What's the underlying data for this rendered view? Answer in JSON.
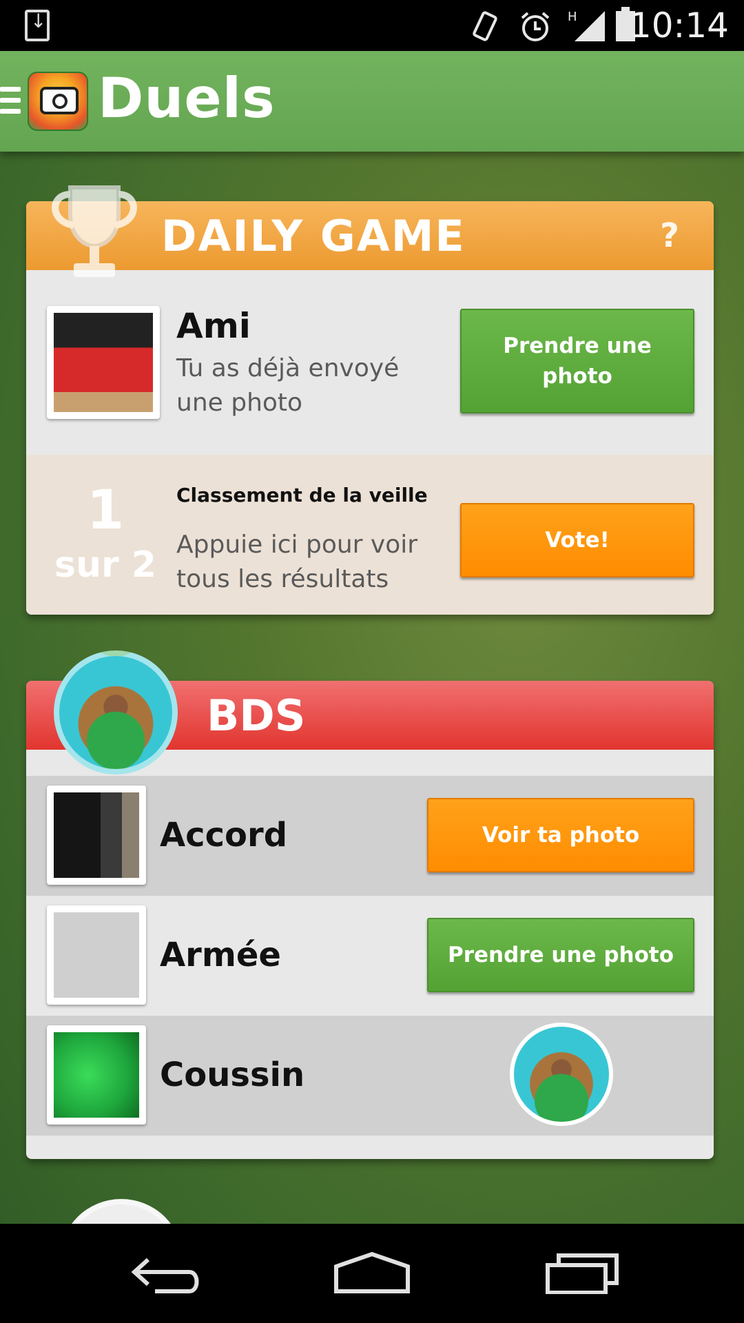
{
  "status_bar": {
    "time": "10:14",
    "icons": [
      "download-icon",
      "vibrate-icon",
      "alarm-icon",
      "signal-icon",
      "battery-icon"
    ]
  },
  "app_bar": {
    "title": "Duels"
  },
  "daily_game": {
    "header": "DAILY GAME",
    "help": "?",
    "entry": {
      "title": "Ami",
      "subtitle": "Tu as déjà envoyé une photo",
      "button": "Prendre une photo"
    },
    "ranking": {
      "rank": "1",
      "out_of": "sur 2",
      "title": "Classement de la veille",
      "subtitle": "Appuie ici pour voir tous les résultats",
      "button": "Vote!"
    }
  },
  "group": {
    "name": "BDS",
    "rows": [
      {
        "name": "Accord",
        "button": "Voir ta photo",
        "button_color": "orange"
      },
      {
        "name": "Armée",
        "button": "Prendre une photo",
        "button_color": "green"
      },
      {
        "name": "Coussin"
      }
    ]
  },
  "colors": {
    "app_bar": "#68aa55",
    "daily_header": "#f0a33f",
    "group_header": "#e84542",
    "button_green": "#5fac3e",
    "button_orange": "#ff9200"
  }
}
